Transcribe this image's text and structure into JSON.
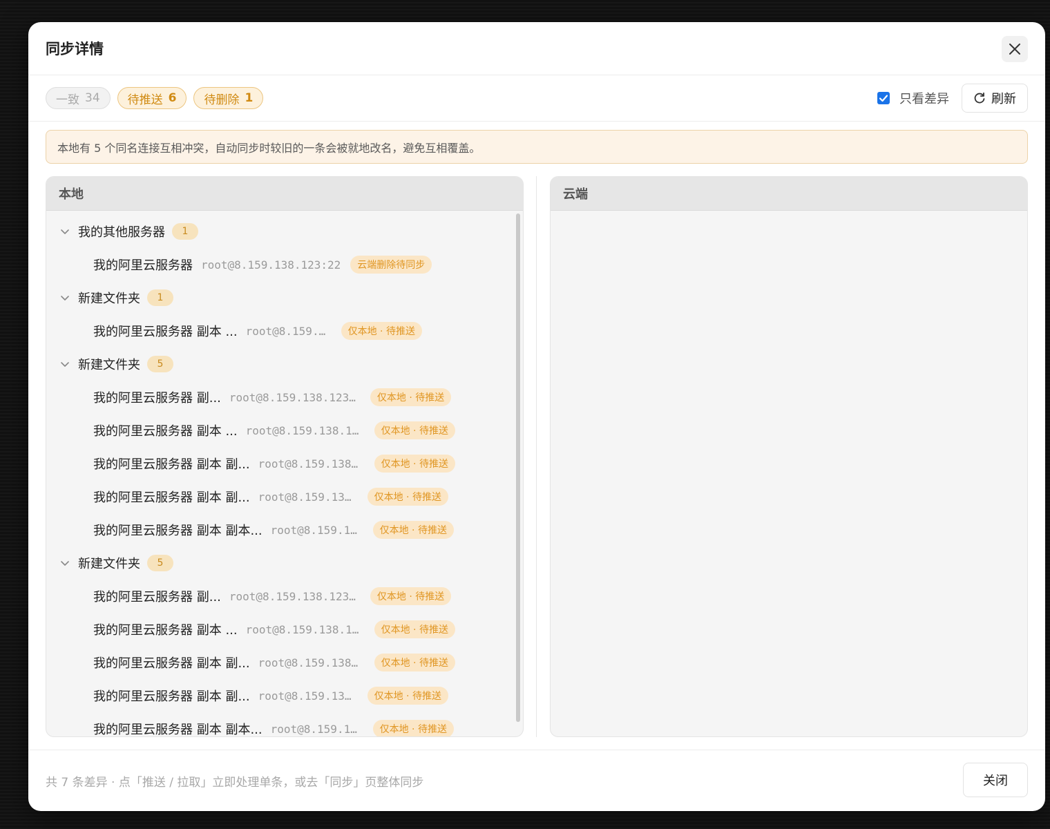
{
  "modal": {
    "title": "同步详情",
    "close_icon": "close-icon"
  },
  "filters": [
    {
      "label": "一致",
      "count": "34",
      "state": "inactive"
    },
    {
      "label": "待推送",
      "count": "6",
      "state": "active"
    },
    {
      "label": "待删除",
      "count": "1",
      "state": "active"
    }
  ],
  "toolbar": {
    "diff_only_label": "只看差异",
    "diff_only_checked": true,
    "refresh_label": "刷新",
    "refresh_icon": "refresh-icon"
  },
  "notice": "本地有 5 个同名连接互相冲突，自动同步时较旧的一条会被就地改名，避免互相覆盖。",
  "local_panel": {
    "title": "本地",
    "groups": [
      {
        "name": "我的其他服务器",
        "count": "1",
        "items": [
          {
            "name": "我的阿里云服务器",
            "host": "root@8.159.138.123:22",
            "status": "云端删除待同步"
          }
        ]
      },
      {
        "name": "新建文件夹",
        "count": "1",
        "items": [
          {
            "name": "我的阿里云服务器 副本 ...",
            "host": "root@8.159....",
            "status": "仅本地 · 待推送"
          }
        ]
      },
      {
        "name": "新建文件夹",
        "count": "5",
        "items": [
          {
            "name": "我的阿里云服务器 副...",
            "host": "root@8.159.138.123...",
            "status": "仅本地 · 待推送"
          },
          {
            "name": "我的阿里云服务器 副本 ...",
            "host": "root@8.159.138.1...",
            "status": "仅本地 · 待推送"
          },
          {
            "name": "我的阿里云服务器 副本 副...",
            "host": "root@8.159.138...",
            "status": "仅本地 · 待推送"
          },
          {
            "name": "我的阿里云服务器 副本 副...",
            "host": "root@8.159.13...",
            "status": "仅本地 · 待推送"
          },
          {
            "name": "我的阿里云服务器 副本 副本...",
            "host": "root@8.159.1...",
            "status": "仅本地 · 待推送"
          }
        ]
      },
      {
        "name": "新建文件夹",
        "count": "5",
        "items": [
          {
            "name": "我的阿里云服务器 副...",
            "host": "root@8.159.138.123...",
            "status": "仅本地 · 待推送"
          },
          {
            "name": "我的阿里云服务器 副本 ...",
            "host": "root@8.159.138.1...",
            "status": "仅本地 · 待推送"
          },
          {
            "name": "我的阿里云服务器 副本 副...",
            "host": "root@8.159.138...",
            "status": "仅本地 · 待推送"
          },
          {
            "name": "我的阿里云服务器 副本 副...",
            "host": "root@8.159.13...",
            "status": "仅本地 · 待推送"
          },
          {
            "name": "我的阿里云服务器 副本 副本...",
            "host": "root@8.159.1...",
            "status": "仅本地 · 待推送"
          }
        ]
      }
    ]
  },
  "cloud_panel": {
    "title": "云端"
  },
  "footer": {
    "summary": "共 7 条差异 · 点「推送 / 拉取」立即处理单条，或去「同步」页整体同步",
    "close_label": "关闭"
  }
}
